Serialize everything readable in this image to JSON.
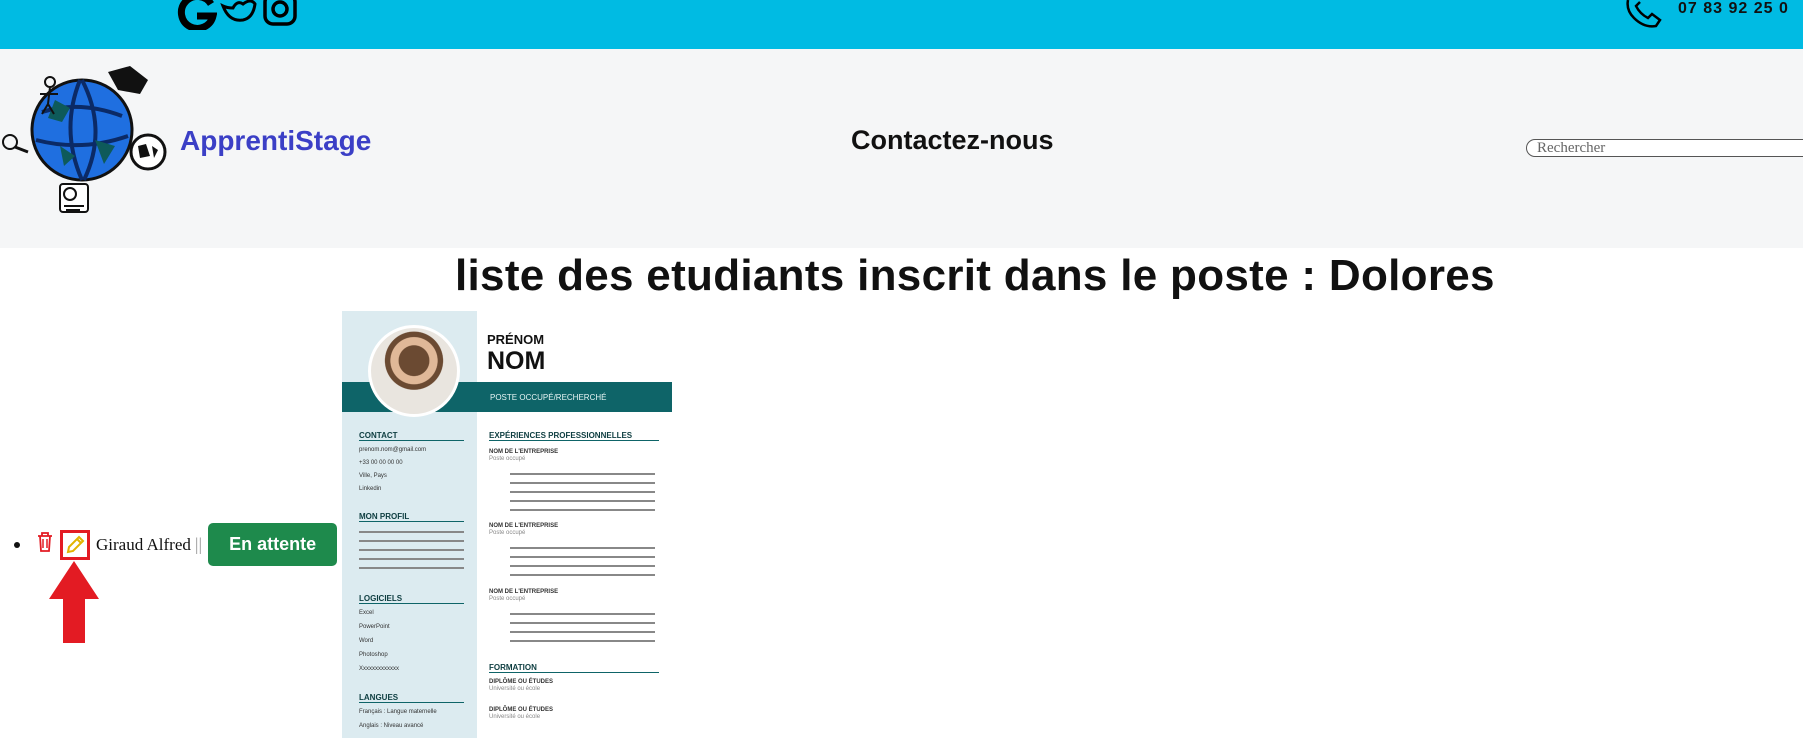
{
  "topbar": {
    "phone": "07 83 92 25 0",
    "social_icons": [
      "google-icon",
      "twitter-icon",
      "instagram-icon"
    ],
    "color": "#00bbe3"
  },
  "header": {
    "brand": "ApprentiStage",
    "contact_link": "Contactez-nous",
    "search_placeholder": "Rechercher"
  },
  "main": {
    "title": "liste des etudiants inscrit dans le poste : Dolores",
    "students": [
      {
        "name": "Giraud Alfred",
        "separator": "||",
        "status": "En attente",
        "status_color": "#1e8a4c"
      }
    ]
  },
  "cv": {
    "prenom": "PRÉNOM",
    "nom": "NOM",
    "poste": "POSTE OCCUPÉ/RECHERCHÉ",
    "contact_title": "CONTACT",
    "contact_items": [
      "prenom.nom@gmail.com",
      "+33 00 00 00 00",
      "Ville, Pays",
      "Linkedin"
    ],
    "profil_title": "MON PROFIL",
    "logiciels_title": "LOGICIELS",
    "logiciels": [
      "Excel",
      "PowerPoint",
      "Word",
      "Photoshop",
      "Xxxxxxxxxxxxx"
    ],
    "langues_title": "LANGUES",
    "langues": [
      "Français : Langue maternelle",
      "Anglais : Niveau avancé"
    ],
    "experiences_title": "EXPÉRIENCES PROFESSIONNELLES",
    "entreprise": "NOM DE L'ENTREPRISE",
    "poste_occupe": "Poste occupé",
    "formation_title": "FORMATION",
    "diplome": "DIPLÔME OU ÉTUDES",
    "ecole": "Université ou école"
  }
}
